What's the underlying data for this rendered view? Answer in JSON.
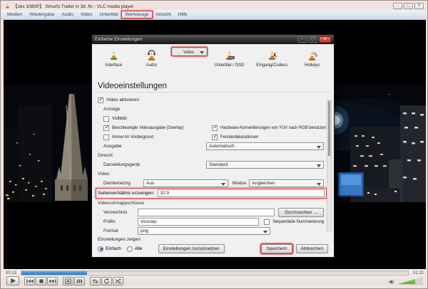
{
  "titlebar": {
    "title": "【sbs 1080P】 Smurfs Trailer in 3d .flv - VLC media player"
  },
  "menubar": {
    "items": [
      "Medien",
      "Wiedergabe",
      "Audio",
      "Video",
      "Untertitel",
      "Werkzeuge",
      "Ansicht",
      "Hilfe"
    ]
  },
  "dialog": {
    "title": "Einfache Einstellungen",
    "tabs": [
      {
        "label": "Interface",
        "selected": false
      },
      {
        "label": "Audio",
        "selected": false
      },
      {
        "label": "Video",
        "selected": true
      },
      {
        "label": "Untertitel / OSD",
        "selected": false
      },
      {
        "label": "Eingang/Codecs",
        "selected": false
      },
      {
        "label": "Hotkeys",
        "selected": false
      }
    ],
    "heading": "Videoeinstellungen",
    "groups": {
      "anzeige": "Anzeige",
      "directx": "DirectX",
      "video": "Video",
      "schnappschuesse": "Videoschnappschüsse"
    },
    "checkboxes": {
      "video_aktivieren": "Video aktivieren",
      "vollbild": "Vollbild",
      "overlay": "Beschleunigte Videoausgabe (Overlay)",
      "yuv_rgb": "Hardware-Konvertierungen von YUV nach RGB benutzen",
      "vordergrund": "Immer im Vordergrund",
      "fensterdekorationen": "Fensterdekorationen",
      "seq_nummerierung": "Sequentielle Nummerierung"
    },
    "labels": {
      "ausgabe": "Ausgabe",
      "darstellungsgeraet": "Darstellungsgerät",
      "deinterlacing": "Deinterlacing",
      "modus": "Modus",
      "seitenverhaeltnis": "Seitenverhältnis erzwingen:",
      "verzeichnis": "Verzeichnis",
      "praefix": "Präfix",
      "format": "Format"
    },
    "values": {
      "ausgabe": "Automatisch",
      "darstellungsgeraet": "Standard",
      "deinterlacing": "Aus",
      "modus": "Angleichen",
      "seitenverhaeltnis": "32:9",
      "verzeichnis": "",
      "praefix": "vlcsnap-",
      "format": "png"
    },
    "states": {
      "video_aktivieren": true,
      "vollbild": false,
      "overlay": true,
      "yuv_rgb": true,
      "vordergrund": false,
      "fensterdekorationen": true,
      "seq_nummerierung": false,
      "einfach": true,
      "alle": false
    },
    "footer": {
      "einstellungen_zeigen": "Einstellungen zeigen",
      "einfach": "Einfach",
      "alle": "Alle",
      "zuruecksetzen": "Einstellungen zurücksetzen",
      "durchsuchen": "Durchsuchen ...",
      "speichern": "Speichern",
      "abbrechen": "Abbrechen"
    }
  },
  "player": {
    "time_elapsed": "00:13",
    "time_total": "01:22",
    "progress_percent": 17,
    "volume_percent": 70
  },
  "icons": {
    "minimize": "–",
    "maximize": "▢",
    "close": "✕"
  },
  "colors": {
    "highlight_red": "#e23b3b",
    "progress_blue": "#2e77c4",
    "volume_green": "#5cb32a",
    "dialog_bg": "#f0f0f0"
  }
}
